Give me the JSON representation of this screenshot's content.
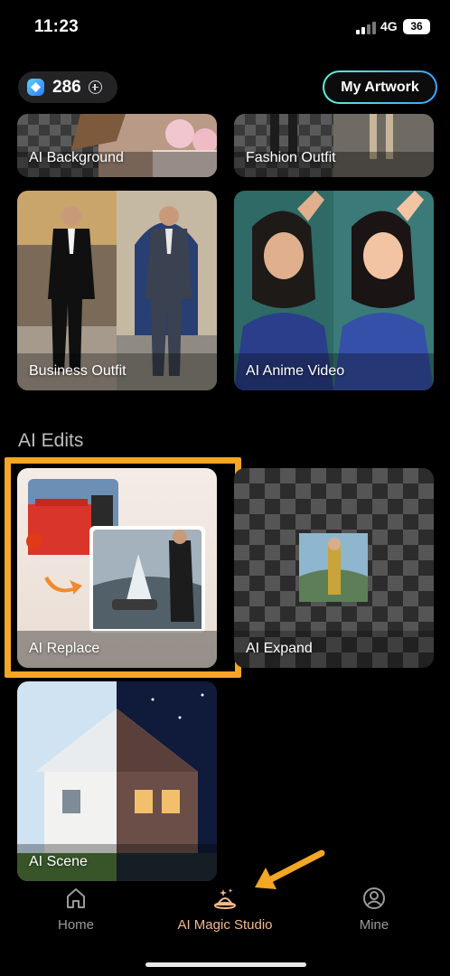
{
  "status_bar": {
    "time": "11:23",
    "network": "4G",
    "battery": "36"
  },
  "header": {
    "credits": "286",
    "my_artwork_label": "My Artwork"
  },
  "cards_top": [
    {
      "label": "AI Background"
    },
    {
      "label": "Fashion Outfit"
    },
    {
      "label": "Business Outfit"
    },
    {
      "label": "AI Anime Video"
    }
  ],
  "ai_edits": {
    "title": "AI Edits",
    "cards": [
      {
        "label": "AI Replace"
      },
      {
        "label": "AI Expand"
      },
      {
        "label": "AI Scene"
      }
    ]
  },
  "nav": {
    "items": [
      {
        "label": "Home",
        "icon": "home-icon"
      },
      {
        "label": "AI Magic Studio",
        "icon": "magic-hat-icon",
        "active": true
      },
      {
        "label": "Mine",
        "icon": "profile-icon"
      }
    ]
  },
  "colors": {
    "accent_orange": "#f5a623",
    "active_nav": "#f2b98a",
    "artwork_border_start": "#5ff0d8",
    "artwork_border_end": "#3aa4ff"
  }
}
